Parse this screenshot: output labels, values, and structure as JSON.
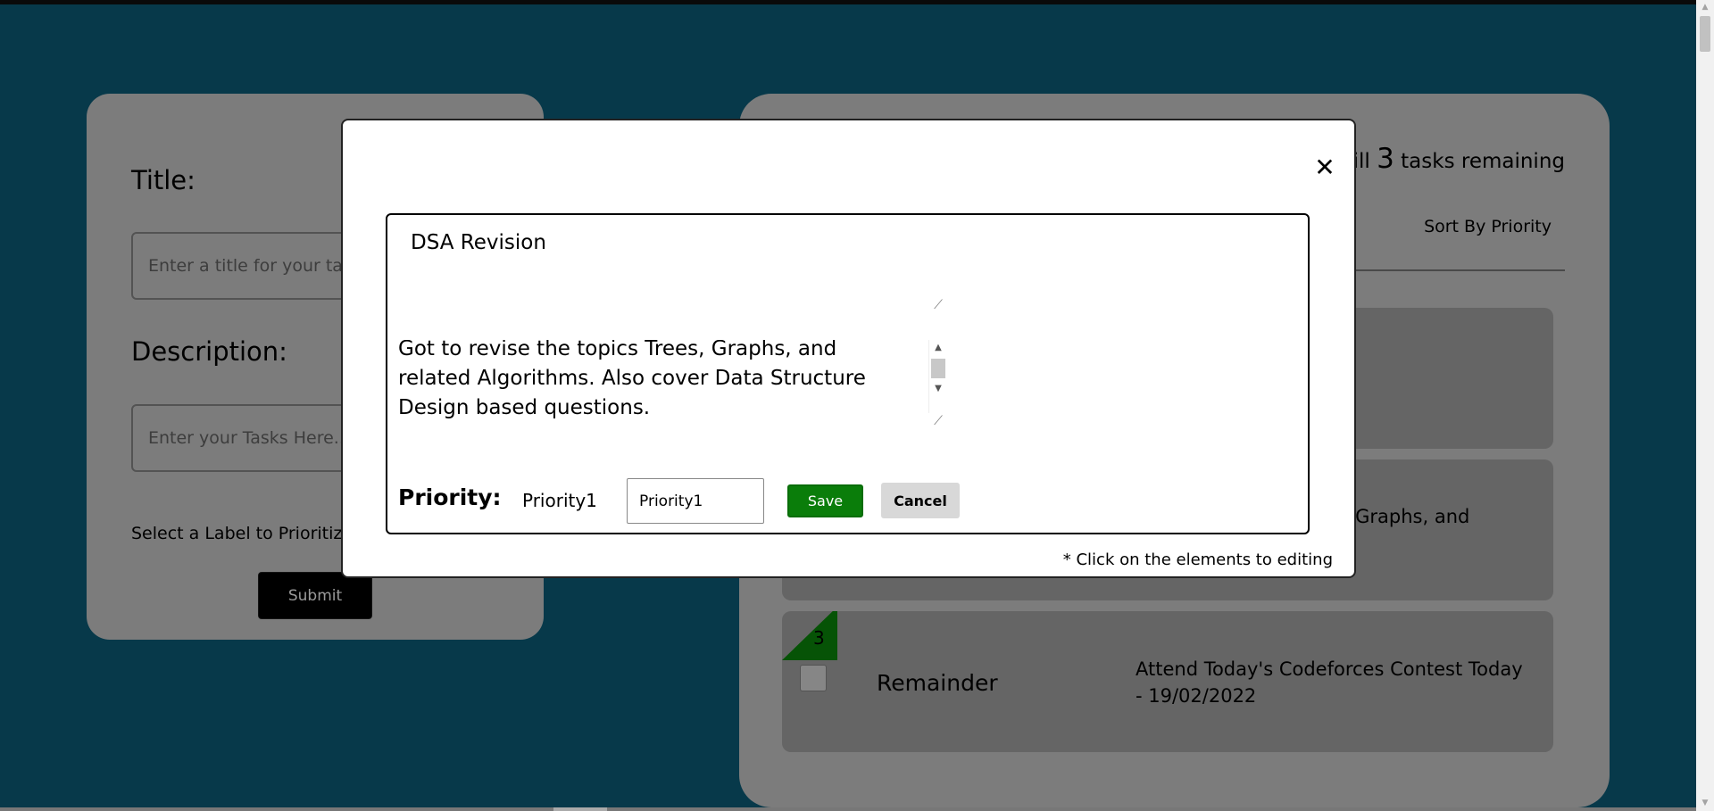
{
  "form": {
    "title_label": "Title:",
    "title_placeholder": "Enter a title for your task",
    "description_label": "Description:",
    "description_placeholder": "Enter your Tasks Here...",
    "priority_label": "Select a Label to Prioritize:",
    "submit_label": "Submit"
  },
  "tasks_panel": {
    "remaining_prefix": "Still",
    "remaining_count": "3",
    "remaining_suffix": "tasks remaining",
    "sort_label": "Sort By Priority",
    "tasks": [
      {
        "description_partial": "ees, Graphs, and"
      },
      {
        "priority": "3",
        "title": "Remainder",
        "description": "Attend Today's Codeforces Contest Today - 19/02/2022"
      }
    ]
  },
  "modal": {
    "title_value": "DSA Revision",
    "description_value": "Got to revise the topics Trees, Graphs, and related Algorithms. Also cover Data Structure Design based questions.",
    "priority_label": "Priority:",
    "priority_value": "Priority1",
    "priority_input_value": "Priority1",
    "save_label": "Save",
    "cancel_label": "Cancel",
    "hint": "* Click on the elements to editing",
    "close_glyph": "✕"
  },
  "colors": {
    "background": "#0c5f7c",
    "save": "#0a7d0a",
    "priority_flag": "#0a8a0a"
  }
}
